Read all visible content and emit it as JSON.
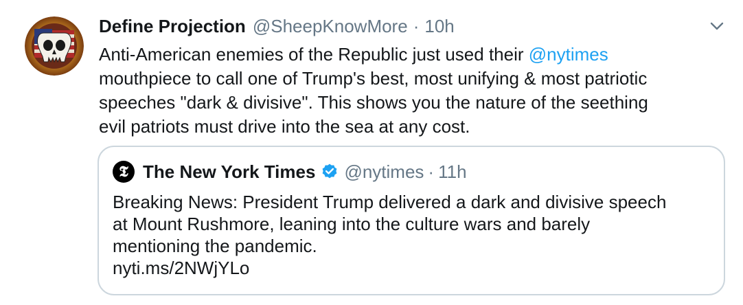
{
  "tweet": {
    "avatar_icon": "punisher-skull-avatar",
    "display_name": "Define Projection",
    "handle": "@SheepKnowMore",
    "separator": "·",
    "time": "10h",
    "caret_icon": "chevron-down-icon",
    "text_lines": [
      {
        "before": "Anti-American enemies of the Republic just used their ",
        "mention": "@nytimes"
      },
      {
        "text": "mouthpiece to call one of Trump's best, most unifying & most patriotic"
      },
      {
        "text": "speeches \"dark & divisive\". This shows you the nature of the seething"
      },
      {
        "text": "evil patriots must drive into the sea at any cost."
      }
    ]
  },
  "quote": {
    "logo_icon": "nyt-logo-icon",
    "logo_glyph": "𝕿",
    "display_name": "The New York Times",
    "verified_icon": "verified-badge-icon",
    "handle": "@nytimes",
    "separator": "·",
    "time": "11h",
    "text_lines": [
      "Breaking News: President Trump delivered a dark and divisive speech",
      "at Mount Rushmore, leaning into the culture wars and barely",
      "mentioning the pandemic.",
      "nyti.ms/2NWjYLo"
    ]
  },
  "colors": {
    "text": "#14171a",
    "secondary": "#657786",
    "link": "#1da1f2",
    "border": "#ccd6dd"
  }
}
